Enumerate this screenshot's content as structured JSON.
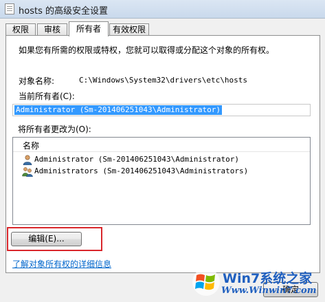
{
  "window": {
    "title": "hosts 的高级安全设置"
  },
  "tabs": [
    {
      "label": "权限"
    },
    {
      "label": "审核"
    },
    {
      "label": "所有者"
    },
    {
      "label": "有效权限"
    }
  ],
  "owner_tab": {
    "intro": "如果您有所需的权限或特权，您就可以取得或分配这个对象的所有权。",
    "object_name_label": "对象名称:",
    "object_name_value": "C:\\Windows\\System32\\drivers\\etc\\hosts",
    "current_owner_label": "当前所有者(C):",
    "current_owner_value": "Administrator (Sm-201406251043\\Administrator)",
    "change_owner_label": "将所有者更改为(O):",
    "list": {
      "header": "名称",
      "items": [
        {
          "name": "Administrator (Sm-201406251043\\Administrator)",
          "icon": "user-icon"
        },
        {
          "name": "Administrators (Sm-201406251043\\Administrators)",
          "icon": "group-icon"
        }
      ]
    },
    "edit_button": "编辑(E)...",
    "details_link": "了解对象所有权的详细信息"
  },
  "footer": {
    "ok_button": "确定"
  },
  "watermark": {
    "brand": "Win7系统之家",
    "url": "Www.Winwin7.com"
  },
  "colors": {
    "selection": "#3399ff",
    "highlight_box": "#d9262b",
    "link": "#0066cc"
  }
}
